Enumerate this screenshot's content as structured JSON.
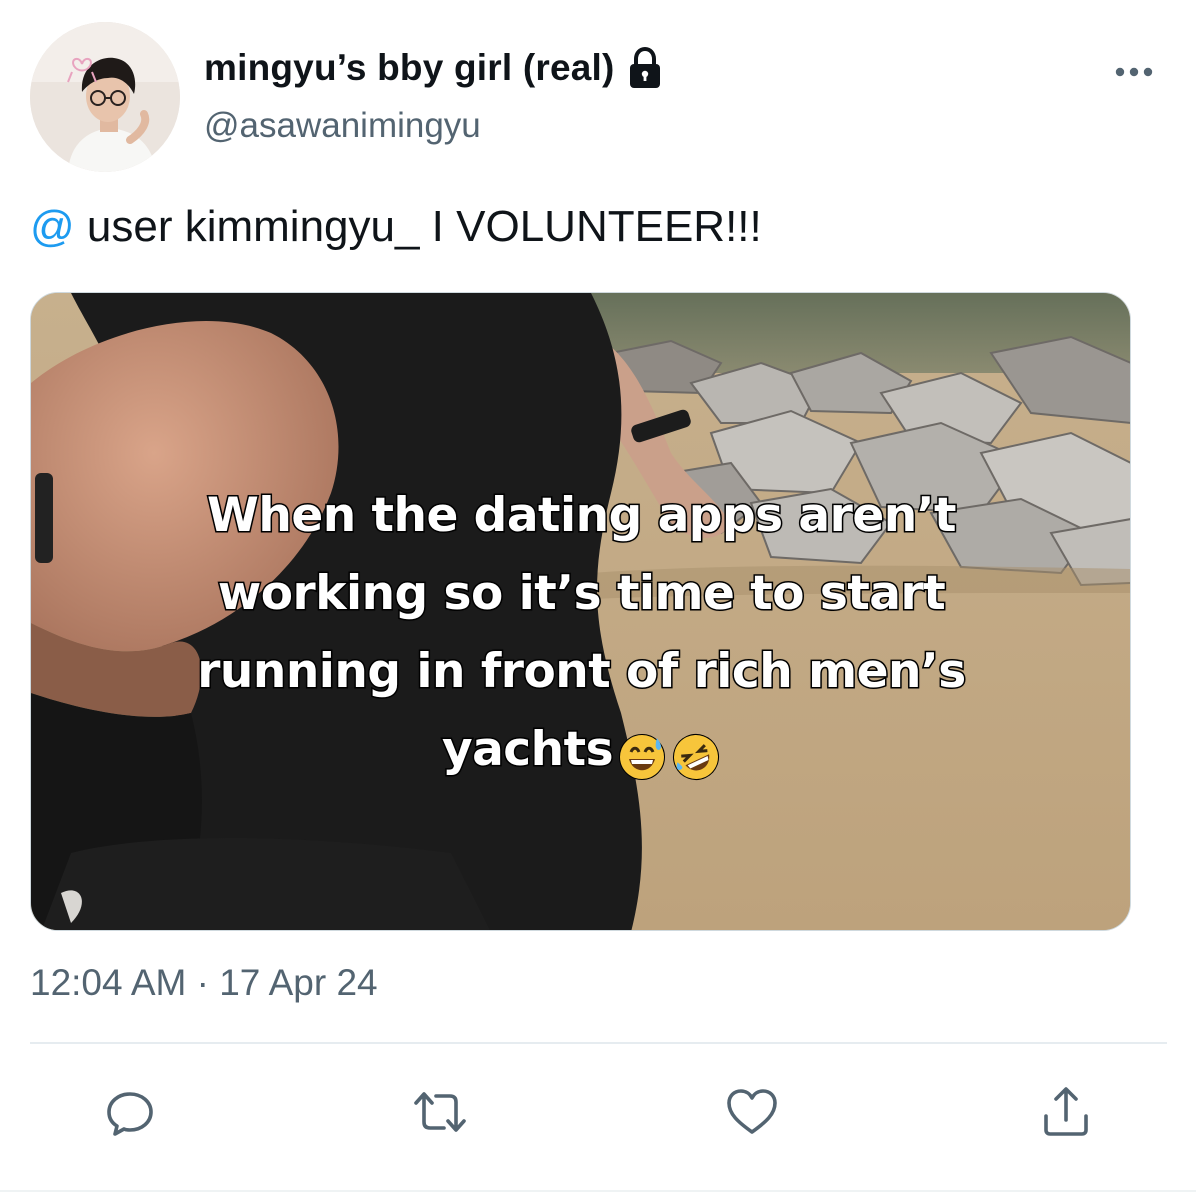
{
  "author": {
    "display_name": "mingyu’s bby girl (real)",
    "handle": "@asawanimingyu",
    "protected_icon": "lock-icon",
    "avatar": "avatar-photo"
  },
  "tweet": {
    "mention_symbol": "@",
    "text": " user kimmingyu_ I VOLUNTEER!!!",
    "timestamp": "12:04 AM · 17 Apr 24"
  },
  "media": {
    "caption_lines": [
      "When the dating apps aren’t",
      "working so it’s time to start",
      "running in front of rich men’s",
      "yachts"
    ],
    "caption_emojis": [
      "grinning-sweat-emoji",
      "rofl-emoji"
    ]
  },
  "actions": {
    "reply_icon": "reply-icon",
    "retweet_icon": "retweet-icon",
    "like_icon": "heart-icon",
    "share_icon": "share-icon"
  },
  "menu_icon": "more-icon",
  "colors": {
    "link": "#1d9bf0",
    "secondary_text": "#536471",
    "icon": "#536471",
    "divider": "#e6ecf0"
  }
}
